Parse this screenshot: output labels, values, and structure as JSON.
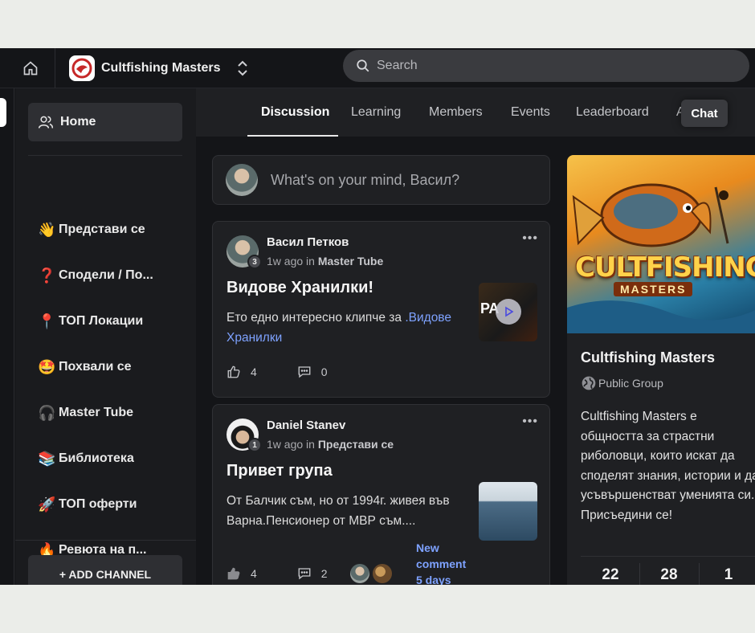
{
  "header": {
    "brand_name": "Cultfishing Masters",
    "search_placeholder": "Search"
  },
  "sidebar": {
    "home_label": "Home",
    "channels": [
      {
        "emoji": "👋",
        "label": "Представи се"
      },
      {
        "emoji": "❓",
        "label": "Сподели / По..."
      },
      {
        "emoji": "📍",
        "label": "ТОП Локации"
      },
      {
        "emoji": "🤩",
        "label": "Похвали се"
      },
      {
        "emoji": "🎧",
        "label": "Master Tube"
      },
      {
        "emoji": "📚",
        "label": "Библиотека"
      },
      {
        "emoji": "🚀",
        "label": "ТОП оферти"
      },
      {
        "emoji": "🔥",
        "label": "Ревюта на п..."
      }
    ],
    "add_channel_label": "+ ADD CHANNEL"
  },
  "tabs": [
    {
      "label": "Discussion",
      "active": true
    },
    {
      "label": "Learning",
      "active": false
    },
    {
      "label": "Members",
      "active": false
    },
    {
      "label": "Events",
      "active": false
    },
    {
      "label": "Leaderboard",
      "active": false
    },
    {
      "label": "A",
      "active": false
    }
  ],
  "chat_label": "Chat",
  "composer": {
    "prompt": "What's on your mind, Васил?"
  },
  "posts": [
    {
      "author": "Васил Петков",
      "level": "3",
      "time": "1w ago",
      "in_word": "in",
      "channel": "Master Tube",
      "title": "Видове Хранилки!",
      "body_text": "Ето едно интересно клипче за",
      "body_link": ".Видове Хранилки",
      "thumb_text": "РА",
      "likes": "4",
      "comments": "0"
    },
    {
      "author": "Daniel Stanev",
      "level": "1",
      "time": "1w ago",
      "in_word": "in",
      "channel": "Представи се",
      "title": "Привет група",
      "body_text": "От Балчик съм, но от 1994г. живея във Варна.Пенсионер от МВР съм....",
      "likes": "4",
      "comments": "2",
      "new_comment_line1": "New",
      "new_comment_line2": "comment",
      "new_comment_line3": "5 days"
    }
  ],
  "group": {
    "banner_title": "CULTFISHING",
    "banner_sub": "MASTERS",
    "name": "Cultfishing Masters",
    "type": "Public Group",
    "description": "Cultfishing Masters е общността за страстни риболовци, които искат да споделят знания, истории и да усъвършенстват уменията си. Присъедини се!",
    "stats": [
      "22",
      "28",
      "1"
    ]
  },
  "colors": {
    "app_bg": "#141518",
    "panel_bg": "#1f2023",
    "link": "#7ea2ff"
  }
}
